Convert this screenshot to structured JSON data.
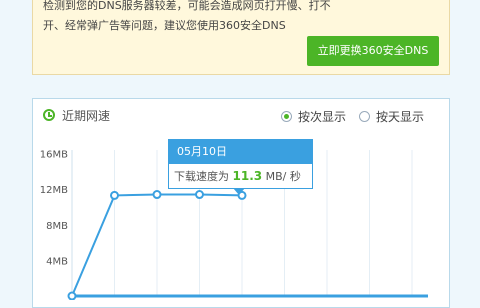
{
  "notice": {
    "text": "检测到您的DNS服务器较差，可能会造成网页打开慢、打不开、经常弹广告等问题，建议您使用360安全DNS",
    "button_label": "立即更换360安全DNS"
  },
  "panel": {
    "title": "近期网速",
    "view_options": [
      {
        "label": "按次显示",
        "selected": true
      },
      {
        "label": "按天显示",
        "selected": false
      }
    ]
  },
  "chart_data": {
    "type": "line",
    "title": "",
    "y_ticks": [
      "16MB",
      "12MB",
      "8MB",
      "4MB"
    ],
    "ylim": [
      0,
      18
    ],
    "x": [
      0,
      1,
      2,
      3,
      4
    ],
    "values": [
      0,
      11.3,
      11.4,
      11.4,
      11.3
    ],
    "grid": true,
    "series_color": "#3aa0e0"
  },
  "tooltip": {
    "date": "05月10日",
    "label": "下载速度为",
    "value": "11.3",
    "unit": "MB/ 秒"
  },
  "colors": {
    "accent": "#4cb527",
    "line": "#3aa0e0"
  }
}
